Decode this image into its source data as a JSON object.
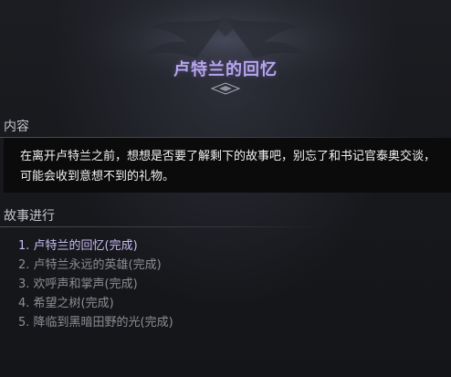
{
  "window": {
    "title": "卢特兰的回忆"
  },
  "content_section": {
    "label": "内容",
    "text": "在离开卢特兰之前，想想是否要了解剩下的故事吧，别忘了和书记官泰奥交谈，可能会收到意想不到的礼物。"
  },
  "story_section": {
    "label": "故事进行",
    "items": [
      {
        "text": "1. 卢特兰的回忆(完成)",
        "active": true
      },
      {
        "text": "2. 卢特兰永远的英雄(完成)",
        "active": false
      },
      {
        "text": "3. 欢呼声和掌声(完成)",
        "active": false
      },
      {
        "text": "4. 希望之树(完成)",
        "active": false
      },
      {
        "text": "5. 降临到黑暗田野的光(完成)",
        "active": false
      }
    ]
  },
  "colors": {
    "title": "#b7a6ea",
    "active_item": "#c9bdf6",
    "inactive_item": "#8c8e94",
    "background": "#18191d",
    "content_box": "#0b0b0c"
  }
}
